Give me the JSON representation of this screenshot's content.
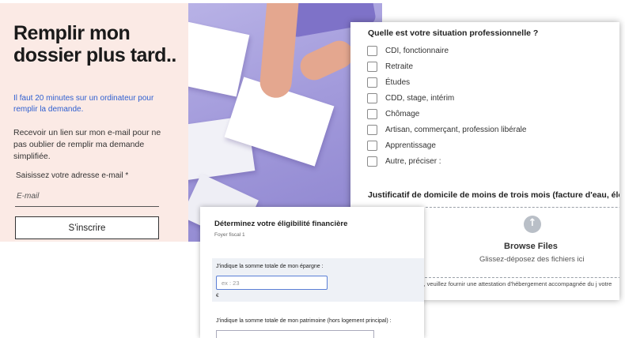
{
  "signup": {
    "title": "Remplir mon dossier plus tard..",
    "info": "Il faut 20 minutes sur un ordinateur pour remplir la demande.",
    "description": "Recevoir un lien sur mon e-mail pour ne pas oublier de remplir ma demande simplifiée.",
    "email_label": "Saisissez votre adresse e-mail *",
    "email_placeholder": "E-mail",
    "email_value": "",
    "button_label": "S'inscrire"
  },
  "professional": {
    "question": "Quelle est votre situation professionnelle ?",
    "options": [
      {
        "label": "CDI, fonctionnaire",
        "checked": false
      },
      {
        "label": "Retraite",
        "checked": false
      },
      {
        "label": "Études",
        "checked": false
      },
      {
        "label": "CDD, stage, intérim",
        "checked": false
      },
      {
        "label": "Chômage",
        "checked": false
      },
      {
        "label": "Artisan, commerçant, profession libérale",
        "checked": false
      },
      {
        "label": "Apprentissage",
        "checked": false
      },
      {
        "label": "Autre, préciser :",
        "checked": false
      }
    ],
    "proof_label": "Justificatif de domicile de moins de trois mois (facture d'eau, élec",
    "upload": {
      "icon": "cloud-upload-icon",
      "title": "Browse Files",
      "subtitle": "Glissez-déposez des fichiers ici"
    },
    "hosted_note": "Si vous êtes hébergé, veuillez fournir une attestation d'hébergement accompagnée du j votre hébergeant"
  },
  "eligibility": {
    "title": "Déterminez votre éligibilité financière",
    "subtitle": "Foyer fiscal 1",
    "savings_label": "J'indique la somme totale de mon épargne :",
    "savings_placeholder": "ex : 23",
    "savings_unit": "€",
    "patrimoine_label": "J'indique la somme totale de mon patrimoine (hors logement principal) :"
  },
  "colors": {
    "signup_bg": "#fbeae5",
    "info_text": "#2f5fd0",
    "photo_bg": "#a29adb",
    "input_focus": "#5b7fd6"
  }
}
